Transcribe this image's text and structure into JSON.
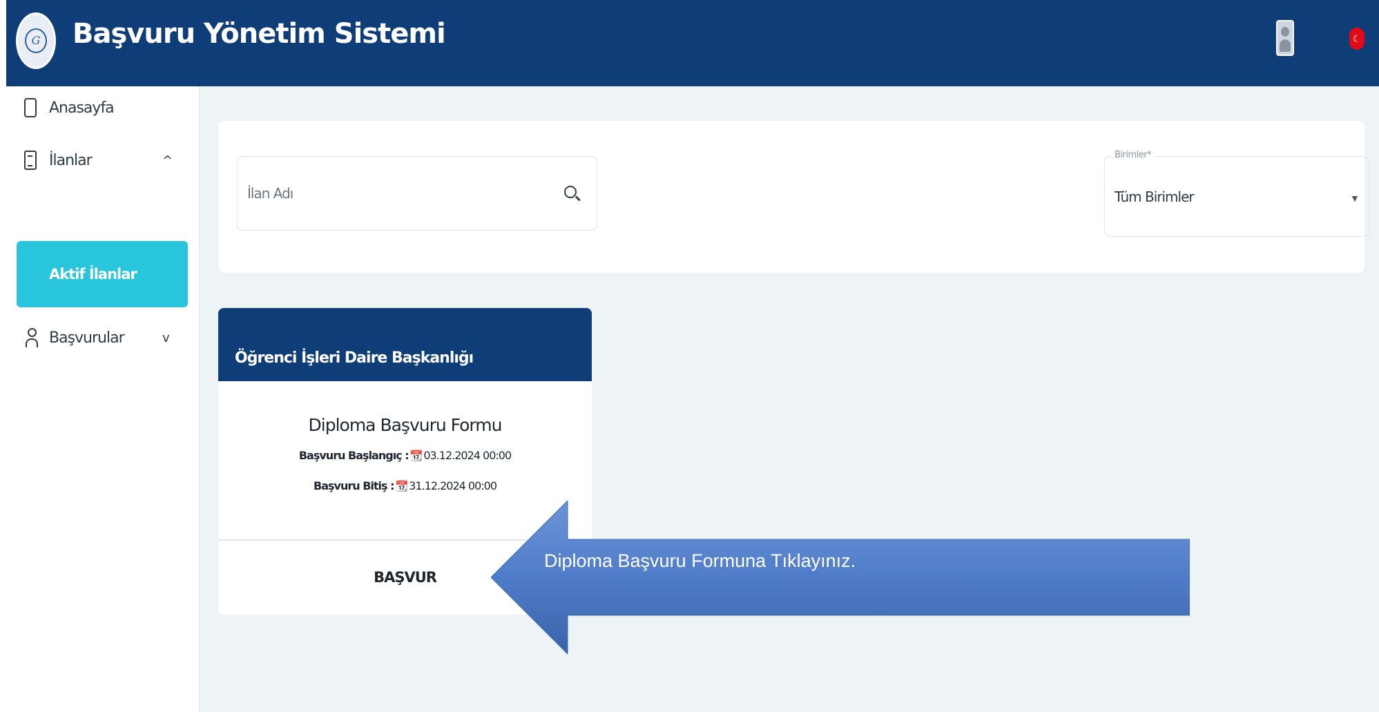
{
  "header": {
    "app_title": "Başvuru Yönetim Sistemi",
    "logo_icon": "university-seal-icon",
    "user_icon": "user-avatar-icon",
    "language_icon": "turkish-flag-icon"
  },
  "sidebar": {
    "items": [
      {
        "label": "Anasayfa",
        "icon": "phone-icon",
        "chevron": ""
      },
      {
        "label": "İlanlar",
        "icon": "document-icon",
        "chevron": "^"
      },
      {
        "label": "Aktif İlanlar",
        "icon": "",
        "chevron": ""
      },
      {
        "label": "Başvurular",
        "icon": "person-icon",
        "chevron": "v"
      }
    ],
    "active_color": "#28c5dc"
  },
  "filters": {
    "search_placeholder": "İlan Adı",
    "search_value": "",
    "unit_legend": "Birimler*",
    "unit_value": "Tüm Birimler"
  },
  "card": {
    "header": "Öğrenci İşleri Daire Başkanlığı",
    "title": "Diploma Başvuru Formu",
    "start_label": "Başvuru Başlangıç :",
    "start_value": "03.12.2024 00:00",
    "end_label": "Başvuru Bitiş :",
    "end_value": "31.12.2024 00:00",
    "apply_label": "BAŞVUR"
  },
  "callout": {
    "text": "Diploma Başvuru Formuna Tıklayınız."
  },
  "colors": {
    "header": "#0f3d78",
    "accent": "#28c5dc",
    "background": "#eef3f6",
    "callout": "#4472c4"
  }
}
